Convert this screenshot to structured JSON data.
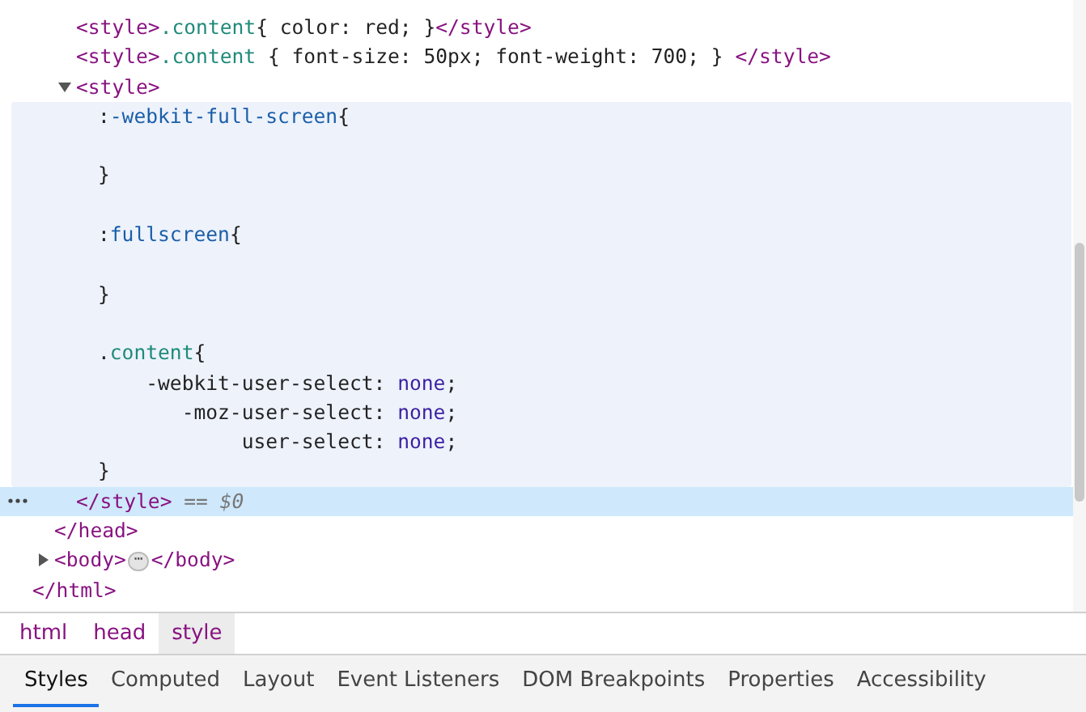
{
  "tree": [
    {
      "close": [
        {
          "kind": "tag",
          "text": "</html>"
        }
      ],
      "children": [
        {
          "close": [
            {
              "kind": "tag",
              "text": "</head>"
            }
          ],
          "children": [
            {
              "open": [
                {
                  "kind": "tag",
                  "text": "<style>"
                },
                {
                  "kind": "class",
                  "text": ".content"
                },
                {
                  "kind": "plain",
                  "text": "{ color: red; }"
                },
                {
                  "kind": "tag",
                  "text": "</style>"
                }
              ]
            },
            {
              "open": [
                {
                  "kind": "tag",
                  "text": "<style>"
                },
                {
                  "kind": "class",
                  "text": ".content"
                },
                {
                  "kind": "plain",
                  "text": " { font-size: 50px; font-weight: 700; } "
                },
                {
                  "kind": "tag",
                  "text": "</style>"
                }
              ]
            },
            {
              "open": [
                {
                  "kind": "tag",
                  "text": "<style>"
                }
              ],
              "expanded": true,
              "selected": true,
              "close": [
                {
                  "kind": "tag",
                  "text": "</style>"
                },
                {
                  "kind": "marker",
                  "text": " == $0"
                }
              ],
              "lines": [
                {
                  "kind": "code",
                  "segments": [
                    {
                      "kind": "plain",
                      "text": ":"
                    },
                    {
                      "kind": "selector",
                      "text": "-webkit-full-screen"
                    },
                    {
                      "kind": "plain",
                      "text": "{"
                    }
                  ]
                },
                {
                  "kind": "blank"
                },
                {
                  "kind": "code",
                  "segments": [
                    {
                      "kind": "plain",
                      "text": "}"
                    }
                  ]
                },
                {
                  "kind": "blank"
                },
                {
                  "kind": "code",
                  "segments": [
                    {
                      "kind": "plain",
                      "text": ":"
                    },
                    {
                      "kind": "selector",
                      "text": "fullscreen"
                    },
                    {
                      "kind": "plain",
                      "text": "{"
                    }
                  ]
                },
                {
                  "kind": "blank"
                },
                {
                  "kind": "code",
                  "segments": [
                    {
                      "kind": "plain",
                      "text": "}"
                    }
                  ]
                },
                {
                  "kind": "blank"
                },
                {
                  "kind": "code",
                  "segments": [
                    {
                      "kind": "plain",
                      "text": "."
                    },
                    {
                      "kind": "class",
                      "text": "content"
                    },
                    {
                      "kind": "plain",
                      "text": "{"
                    }
                  ]
                },
                {
                  "kind": "code",
                  "segments": [
                    {
                      "kind": "plain",
                      "text": "    -webkit-user-select: "
                    },
                    {
                      "kind": "value",
                      "text": "none"
                    },
                    {
                      "kind": "plain",
                      "text": ";"
                    }
                  ]
                },
                {
                  "kind": "code",
                  "segments": [
                    {
                      "kind": "plain",
                      "text": "       -moz-user-select: "
                    },
                    {
                      "kind": "value",
                      "text": "none"
                    },
                    {
                      "kind": "plain",
                      "text": ";"
                    }
                  ]
                },
                {
                  "kind": "code",
                  "segments": [
                    {
                      "kind": "plain",
                      "text": "            user-select: "
                    },
                    {
                      "kind": "value",
                      "text": "none"
                    },
                    {
                      "kind": "plain",
                      "text": ";"
                    }
                  ]
                },
                {
                  "kind": "code",
                  "segments": [
                    {
                      "kind": "plain",
                      "text": "}"
                    }
                  ]
                }
              ]
            }
          ]
        },
        {
          "open": [
            {
              "kind": "tag",
              "text": "<body>"
            },
            {
              "kind": "ellipsis",
              "text": "⋯"
            },
            {
              "kind": "tag",
              "text": "</body>"
            }
          ],
          "expanded": false
        }
      ]
    }
  ],
  "breadcrumbs": [
    {
      "label": "html",
      "selected": false
    },
    {
      "label": "head",
      "selected": false
    },
    {
      "label": "style",
      "selected": true
    }
  ],
  "tabs": [
    {
      "label": "Styles",
      "selected": true
    },
    {
      "label": "Computed",
      "selected": false
    },
    {
      "label": "Layout",
      "selected": false
    },
    {
      "label": "Event Listeners",
      "selected": false
    },
    {
      "label": "DOM Breakpoints",
      "selected": false
    },
    {
      "label": "Properties",
      "selected": false
    },
    {
      "label": "Accessibility",
      "selected": false
    }
  ]
}
